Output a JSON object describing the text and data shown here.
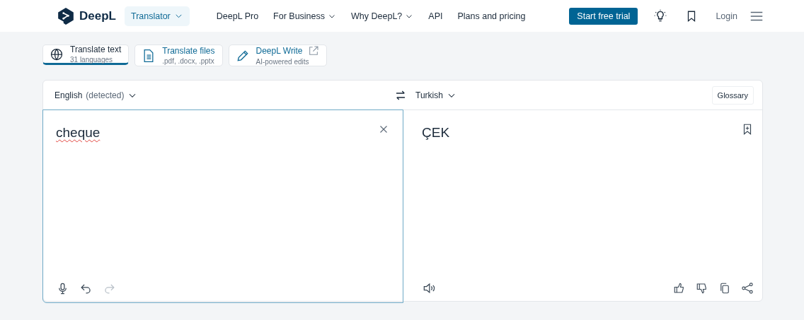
{
  "header": {
    "logo": "DeepL",
    "product": {
      "label": "Translator",
      "dropdown": true
    },
    "nav": [
      {
        "label": "DeepL Pro",
        "dropdown": false
      },
      {
        "label": "For Business",
        "dropdown": true
      },
      {
        "label": "Why DeepL?",
        "dropdown": true
      },
      {
        "label": "API",
        "dropdown": false
      },
      {
        "label": "Plans and pricing",
        "dropdown": false
      }
    ],
    "cta": "Start free trial",
    "login": "Login"
  },
  "modes": [
    {
      "kind": "text",
      "title": "Translate text",
      "subtitle": "31 languages",
      "selected": true,
      "external": false
    },
    {
      "kind": "files",
      "title": "Translate files",
      "subtitle": ".pdf, .docx, .pptx",
      "selected": false,
      "external": false
    },
    {
      "kind": "write",
      "title": "DeepL Write",
      "subtitle": "AI-powered edits",
      "selected": false,
      "external": true
    }
  ],
  "source": {
    "language": "English",
    "detected": "(detected)",
    "text": "cheque",
    "spell_error": true,
    "tools": [
      {
        "kind": "mic",
        "disabled": false
      },
      {
        "kind": "undo",
        "disabled": false
      },
      {
        "kind": "redo",
        "disabled": true
      }
    ]
  },
  "target": {
    "language": "Turkish",
    "glossary": "Glossary",
    "text": "ÇEK",
    "tools": [
      {
        "kind": "thumbs-up",
        "disabled": false
      },
      {
        "kind": "thumbs-down",
        "disabled": false
      },
      {
        "kind": "copy",
        "disabled": false
      },
      {
        "kind": "share",
        "disabled": false
      }
    ]
  }
}
